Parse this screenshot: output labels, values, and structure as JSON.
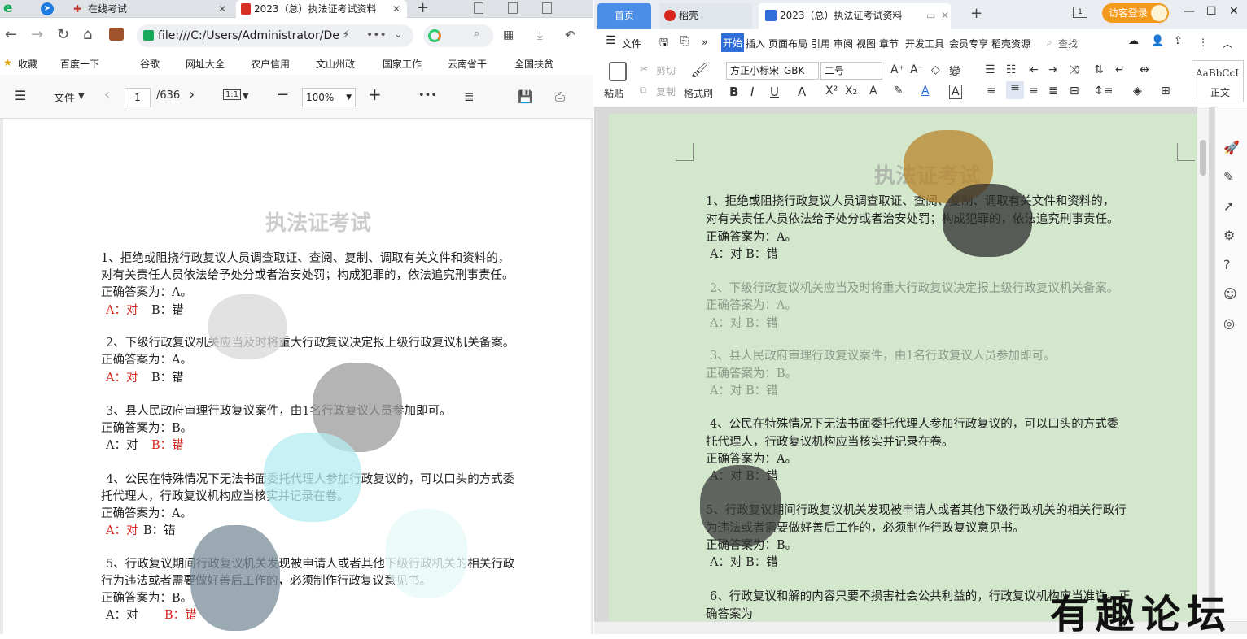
{
  "left_browser": {
    "tabs": [
      {
        "label": "在线考试"
      },
      {
        "label": "2023（总）执法证考试资料"
      }
    ],
    "address": "file:///C:/Users/Administrator/De",
    "bookmarks": [
      "收藏",
      "百度一下",
      "谷歌",
      "网址大全",
      "农户信用",
      "文山州政",
      "国家工作",
      "云南省干",
      "全国扶贫"
    ],
    "pdf_toolbar": {
      "file_label": "文件",
      "page": "1",
      "total": "/636",
      "fit": "1:1",
      "zoom": "100%"
    },
    "doc_title": "执法证考试",
    "questions": [
      {
        "q1": "1、拒绝或阻挠行政复议人员调查取证、查阅、复制、调取有关文件和资料的，",
        "q2": "对有关责任人员依法给予处分或者治安处罚；构成犯罪的，依法追究刑事责任。",
        "ans": "正确答案为：A。",
        "a": "A：对",
        "b": "B：错"
      },
      {
        "q1": "2、下级行政复议机关应当及时将重大行政复议决定报上级行政复议机关备案。",
        "q2": "",
        "ans": "正确答案为：A。",
        "a": "A：对",
        "b": "B：错"
      },
      {
        "q1": "3、县人民政府审理行政复议案件，由1名行政复议人员参加即可。",
        "q2": "",
        "ans": "正确答案为：B。",
        "a": "A：对",
        "b": "B：错"
      },
      {
        "q1": "4、公民在特殊情况下无法书面委托代理人参加行政复议的，可以口头的方式委",
        "q2": "托代理人，行政复议机构应当核实并记录在卷。",
        "ans": "正确答案为：A。",
        "a": "A：对",
        "b": "B：错"
      },
      {
        "q1": "5、行政复议期间行政复议机关发现被申请人或者其他下级行政机关的相关行政",
        "q2": "行为违法或者需要做好善后工作的，必须制作行政复议意见书。",
        "ans": "正确答案为：B。",
        "a": "A：对",
        "b": "B：错"
      }
    ]
  },
  "right_wps": {
    "tabs": [
      {
        "label": "首页"
      },
      {
        "label": "稻壳"
      },
      {
        "label": "2023（总）执法证考试资料"
      }
    ],
    "login": "访客登录",
    "menu": [
      "文件",
      "开始",
      "插入",
      "页面布局",
      "引用",
      "审阅",
      "视图",
      "章节",
      "开发工具",
      "会员专享",
      "稻壳资源"
    ],
    "search": "查找",
    "ribbon": {
      "paste": "粘贴",
      "cut": "剪切",
      "copy": "复制",
      "format_painter": "格式刷",
      "font": "方正小标宋_GBK",
      "size": "二号",
      "style": "正文",
      "style_preview": "AaBbCcI"
    },
    "doc_title": "执法证考试",
    "questions": [
      {
        "q1": "1、拒绝或阻挠行政复议人员调查取证、查阅、复制、调取有关文件和资料的，",
        "q2": "对有关责任人员依法给予处分或者治安处罚；构成犯罪的，依法追究刑事责任。",
        "ans": "正确答案为：A。",
        "opt": "A：对  B：错"
      },
      {
        "q1": "2、下级行政复议机关应当及时将重大行政复议决定报上级行政复议机关备案。",
        "q2": "",
        "ans": "正确答案为：A。",
        "opt": "A：对  B：错"
      },
      {
        "q1": "3、县人民政府审理行政复议案件，由1名行政复议人员参加即可。",
        "q2": "",
        "ans": "正确答案为：B。",
        "opt": "A：对  B：错"
      },
      {
        "q1": "4、公民在特殊情况下无法书面委托代理人参加行政复议的，可以口头的方式委",
        "q2": "托代理人，行政复议机构应当核实并记录在卷。",
        "ans": "正确答案为：A。",
        "opt": "A：对  B：错"
      },
      {
        "q1": "5、行政复议期间行政复议机关发现被申请人或者其他下级行政机关的相关行政行",
        "q2": "为违法或者需要做好善后工作的，必须制作行政复议意见书。",
        "ans": "正确答案为：B。",
        "opt": "A：对  B：错"
      },
      {
        "q1": "6、行政复议和解的内容只要不损害社会公共利益的，行政复议机构应当准许。正",
        "q2": "确答案为",
        "ans": "",
        "opt": ""
      }
    ]
  },
  "watermark": "有趣论坛",
  "colors": {
    "accent": "#3a7bd5",
    "answer_red": "#d9261c",
    "doc_green": "#d3e7cd",
    "login_orange": "#f39a1d"
  }
}
